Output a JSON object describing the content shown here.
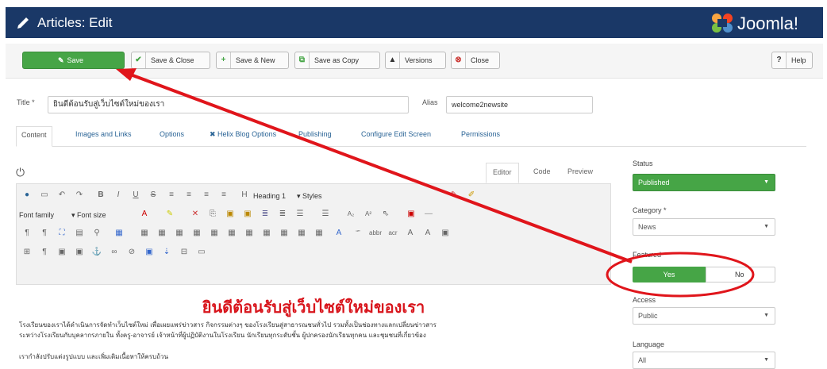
{
  "header": {
    "title": "Articles: Edit",
    "logo_text": "Joomla!"
  },
  "toolbar": {
    "save": "Save",
    "save_close": "Save & Close",
    "save_new": "Save & New",
    "save_copy": "Save as Copy",
    "versions": "Versions",
    "close": "Close",
    "help": "Help"
  },
  "form": {
    "title_label": "Title *",
    "title_value": "ยินดีต้อนรับสู่เว็บไซต์ใหม่ของเรา",
    "alias_label": "Alias",
    "alias_value": "welcome2newsite"
  },
  "tabs": [
    "Content",
    "Images and Links",
    "Options",
    "Helix Blog Options",
    "Publishing",
    "Configure Edit Screen",
    "Permissions"
  ],
  "editor": {
    "tabs": [
      "Editor",
      "Code",
      "Preview"
    ],
    "heading": "Heading 1",
    "styles": "Styles",
    "font_family": "Font family",
    "font_size": "Font size",
    "content_heading": "ยินดีต้อนรับสู่เว็บไซต์ใหม่ของเรา",
    "paragraphs": [
      "โรงเรียนของเราได้ดำเนินการจัดทำเว็บไซต์ใหม่  เพื่อเผยแพร่ข่าวสาร  กิจกรรมต่างๆ  ของโรงเรียนสู่สาธารณชนทั่วไป  รวมทั้งเป็นช่องทางแลกเปลี่ยนข่าวสาร",
      "ระหว่างโรงเรียนกับบุคลากรภายใน ทั้งครู-อาจารย์ เจ้าหน้าที่ผู้ปฏิบัติงานในโรงเรียน นักเรียนทุกระดับชั้น ผู้ปกครองนักเรียนทุกคน และชุมชนที่เกี่ยวข้อง",
      "เรากำลังปรับแต่งรูปแบบ และเพิ่มเติมเนื้อหาให้ครบถ้วน"
    ]
  },
  "sidebar": {
    "status_label": "Status",
    "status_value": "Published",
    "category_label": "Category *",
    "category_value": "News",
    "featured_label": "Featured",
    "featured_yes": "Yes",
    "featured_no": "No",
    "access_label": "Access",
    "access_value": "Public",
    "language_label": "Language",
    "language_value": "All"
  },
  "colors": {
    "header": "#1a3867",
    "green": "#46a546",
    "annotation": "#e0151b",
    "heading": "#d8151c"
  }
}
